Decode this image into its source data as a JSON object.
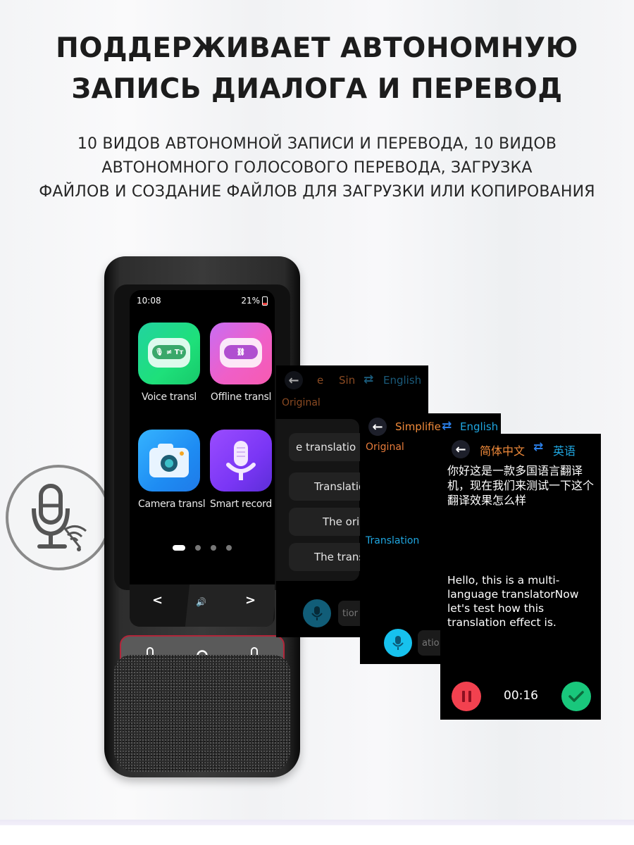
{
  "headline": {
    "line1": "ПОДДЕРЖИВАЕТ АВТОНОМНУЮ",
    "line2": "ЗАПИСЬ ДИАЛОГА И ПЕРЕВОД"
  },
  "subhead": {
    "line1": "10 ВИДОВ АВТОНОМНОЙ ЗАПИСИ И ПЕРЕВОДА, 10 ВИДОВ",
    "line2": "АВТОНОМНОГО ГОЛОСОВОГО ПЕРЕВОДА, ЗАГРУЗКА",
    "line3": "ФАЙЛОВ И СОЗДАНИЕ ФАЙЛОВ ДЛЯ ЗАГРУЗКИ ИЛИ КОПИРОВАНИЯ"
  },
  "badge": {
    "icon": "offline-mic-icon"
  },
  "device": {
    "status": {
      "time": "10:08",
      "battery": "21%"
    },
    "apps": [
      {
        "label": "Voice transl",
        "icon": "voice-translate-icon",
        "pill": "🎙 ≠ Tт"
      },
      {
        "label": "Offline transl",
        "icon": "broken-link-icon",
        "pill": "⛓"
      },
      {
        "label": "Camera transl",
        "icon": "camera-icon"
      },
      {
        "label": "Smart record",
        "icon": "microphone-icon"
      }
    ],
    "pagination": {
      "pages": 4,
      "active": 1
    },
    "nav": {
      "prev": "<",
      "sound": "🔊",
      "next": ">"
    },
    "keypad": {
      "left": "microphone",
      "center": "home",
      "right": "microphone"
    }
  },
  "panels": {
    "menu_screen": {
      "src_lang_partial_1": "e",
      "src_lang_partial_2": "Sin",
      "dst_lang": "English",
      "original_label": "Original",
      "menu_items": [
        "e translatio",
        "Translatio",
        "The orig",
        "The trans"
      ],
      "chip_text": "tior"
    },
    "record_screen": {
      "src_lang": "Simplifie",
      "dst_lang": "English",
      "original_label": "Original",
      "translation_label": "Translation",
      "chip_text": "atio"
    },
    "result_screen": {
      "src_lang": "简体中文",
      "dst_lang": "英语",
      "original_text": "你好这是一款多国语言翻译机，现在我们来测试一下这个翻译效果怎么样",
      "translation_text": "Hello, this is a multi-language translatorNow let's test how this translation effect is.",
      "timer": "00:16"
    }
  },
  "colors": {
    "source_lang": "#f08a3a",
    "target_lang": "#1fa6e0",
    "pause": "#f2414f",
    "done": "#19c77c",
    "accent_red": "#b2263a"
  }
}
